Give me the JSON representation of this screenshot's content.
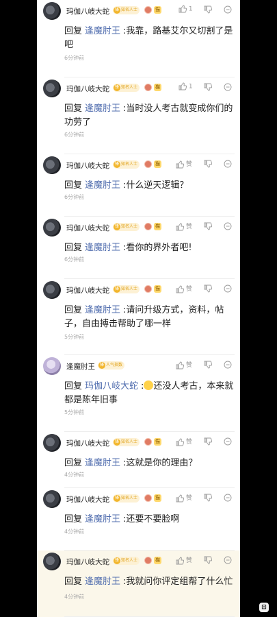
{
  "colors": {
    "mention": "#4f6cae",
    "badge_gold": "#e0a21a",
    "highlight_bg": "#fbf7ea",
    "meta_gray": "#999999"
  },
  "icons": {
    "like": "thumbs-up-icon",
    "dislike": "thumbs-down-icon",
    "more": "more-options-icon",
    "corner": "app-mini-icon"
  },
  "comments": [
    {
      "user": "玛伽八岐大蛇",
      "badge": "知名人士",
      "badge_icon": "锋",
      "level": "",
      "pet": "猫",
      "like": "1",
      "reply_word": "回复",
      "mention": "逢魔肘王",
      "sep": ":",
      "text": "我靠，路基艾尔又切割了是吧",
      "time": "6分钟前"
    },
    {
      "user": "玛伽八岐大蛇",
      "badge": "知名人士",
      "badge_icon": "锋",
      "level": "",
      "pet": "猫",
      "like": "1",
      "reply_word": "回复",
      "mention": "逢魔肘王",
      "sep": ":",
      "text": "当时没人考古就变成你们的功劳了",
      "time": "6分钟前"
    },
    {
      "user": "玛伽八岐大蛇",
      "badge": "知名人士",
      "badge_icon": "锋",
      "level": "",
      "pet": "猫",
      "like": "赞",
      "reply_word": "回复",
      "mention": "逢魔肘王",
      "sep": ":",
      "text": "什么逆天逻辑？",
      "time": "6分钟前"
    },
    {
      "user": "玛伽八岐大蛇",
      "badge": "知名人士",
      "badge_icon": "锋",
      "level": "",
      "pet": "猫",
      "like": "赞",
      "reply_word": "回复",
      "mention": "逢魔肘王",
      "sep": ":",
      "text": "看你的界外者吧!",
      "time": "6分钟前"
    },
    {
      "user": "玛伽八岐大蛇",
      "badge": "知名人士",
      "badge_icon": "锋",
      "level": "",
      "pet": "猫",
      "like": "赞",
      "reply_word": "回复",
      "mention": "逢魔肘王",
      "sep": ":",
      "text": "请问升级方式，资料，帖子，自由搏击帮助了哪一样",
      "time": "5分钟前"
    },
    {
      "user": "逢魔肘王",
      "badge": "人气指数",
      "badge_icon": "锋",
      "level": "",
      "pet": "",
      "like": "赞",
      "reply_word": "回复",
      "mention": "玛伽八岐大蛇",
      "sep": ":",
      "text": "还没人考古，本来就都是陈年旧事",
      "time": "5分钟前",
      "emoji": true,
      "avatar": "light"
    },
    {
      "user": "玛伽八岐大蛇",
      "badge": "知名人士",
      "badge_icon": "锋",
      "level": "",
      "pet": "猫",
      "like": "赞",
      "reply_word": "回复",
      "mention": "逢魔肘王",
      "sep": ":",
      "text": "这就是你的理由？",
      "time": "4分钟前"
    },
    {
      "user": "玛伽八岐大蛇",
      "badge": "知名人士",
      "badge_icon": "锋",
      "level": "",
      "pet": "猫",
      "like": "赞",
      "reply_word": "回复",
      "mention": "逢魔肘王",
      "sep": ":",
      "text": "还要不要脸啊",
      "time": "4分钟前"
    },
    {
      "user": "玛伽八岐大蛇",
      "badge": "知名人士",
      "badge_icon": "锋",
      "level": "",
      "pet": "猫",
      "like": "赞",
      "reply_word": "回复",
      "mention": "逢魔肘王",
      "sep": ":",
      "text": "我就问你评定组帮了什么忙",
      "time": "4分钟前",
      "highlight": true
    }
  ]
}
